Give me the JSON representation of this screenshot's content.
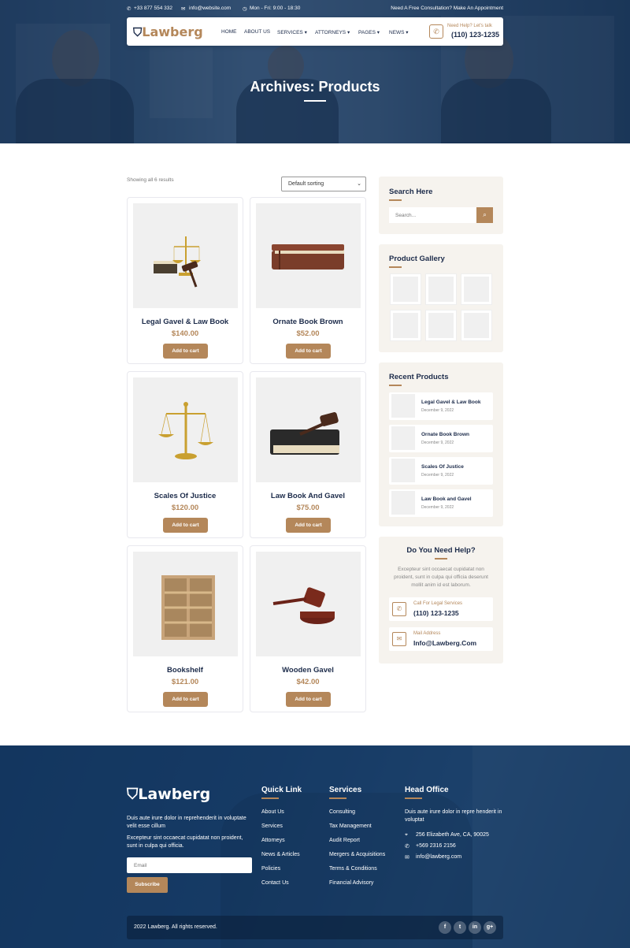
{
  "topbar": {
    "phone": "+33 877 554 332",
    "email": "info@website.com",
    "hours": "Mon - Fri: 9:00 - 18:30",
    "cta": "Need A Free Consultation? Make An Appointment"
  },
  "brand": {
    "name": "Lawberg",
    "accent": "#b4875a",
    "navy": "#1c2b4a"
  },
  "nav": {
    "items": [
      "HOME",
      "ABOUT US",
      "SERVICES",
      "ATTORNEYS",
      "PAGES",
      "NEWS"
    ],
    "call_label": "Need Help? Let's talk",
    "call_number": "(110) 123-1235"
  },
  "hero": {
    "title": "Archives: Products"
  },
  "shop": {
    "result_count": "Showing all 6 results",
    "sorting": "Default sorting",
    "products": [
      {
        "name": "Legal Gavel & Law Book",
        "price": "$140.00",
        "button": "Add to cart"
      },
      {
        "name": "Ornate Book Brown",
        "price": "$52.00",
        "button": "Add to cart"
      },
      {
        "name": "Scales Of Justice",
        "price": "$120.00",
        "button": "Add to cart"
      },
      {
        "name": "Law Book And Gavel",
        "price": "$75.00",
        "button": "Add to cart"
      },
      {
        "name": "Bookshelf",
        "price": "$121.00",
        "button": "Add to cart"
      },
      {
        "name": "Wooden Gavel",
        "price": "$42.00",
        "button": "Add to cart"
      }
    ]
  },
  "sidebar": {
    "search": {
      "title": "Search Here",
      "placeholder": "Search..."
    },
    "gallery": {
      "title": "Product Gallery"
    },
    "recent": {
      "title": "Recent Products",
      "items": [
        {
          "name": "Legal Gavel & Law Book",
          "date": "December 9, 2022"
        },
        {
          "name": "Ornate Book Brown",
          "date": "December 9, 2022"
        },
        {
          "name": "Scales Of Justice",
          "date": "December 9, 2022"
        },
        {
          "name": "Law Book and Gavel",
          "date": "December 9, 2022"
        }
      ]
    },
    "help": {
      "title": "Do You Need Help?",
      "text": "Excepteur sint occaecat cupidatat non proident, sunt in culpa qui officia deserunt mollit anim id est laborum.",
      "call_label": "Call For Legal Services",
      "call_value": "(110) 123-1235",
      "mail_label": "Mail Address",
      "mail_value": "Info@Lawberg.Com"
    }
  },
  "footer": {
    "about1": "Duis aute irure dolor in reprehenderit in voluptate velit esse cillum",
    "about2": "Excepteur sint occaecat cupidatat non proident, sunt in culpa qui officia.",
    "email_placeholder": "Email",
    "subscribe": "Subscribe",
    "quick_title": "Quick Link",
    "quick_links": [
      "About Us",
      "Services",
      "Attorneys",
      "News & Articles",
      "Policies",
      "Contact Us"
    ],
    "services_title": "Services",
    "services": [
      "Consulting",
      "Tax Management",
      "Audit Report",
      "Mergers & Acquisitions",
      "Terms & Conditions",
      "Financial Advisory"
    ],
    "office_title": "Head Office",
    "office_text": "Duis aute irure dolor in repre henderit in voluptat",
    "address": "256 Elizabeth Ave, CA, 90025",
    "phone": "+569 2316 2156",
    "email": "info@lawberg.com",
    "copyright": "2022 Lawberg. All rights reserved.",
    "social": [
      "f",
      "t",
      "in",
      "g+"
    ]
  }
}
